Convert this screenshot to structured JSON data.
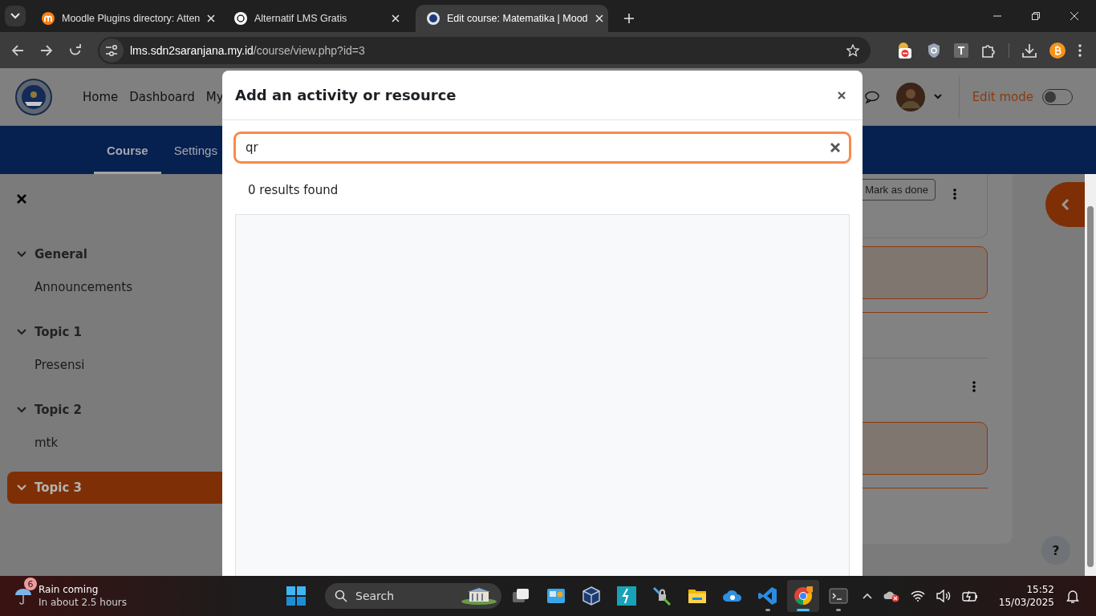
{
  "browser": {
    "tabs": [
      {
        "title": "Moodle Plugins directory: Atten",
        "kind": "moodle",
        "selected": false
      },
      {
        "title": "Alternatif LMS Gratis",
        "kind": "chat",
        "selected": false
      },
      {
        "title": "Edit course: Matematika | Mood",
        "kind": "school",
        "selected": true
      }
    ],
    "url": {
      "host": "lms.sdn2saranjana.my.id",
      "path": "/course/view.php?id=3"
    }
  },
  "site": {
    "nav": [
      "Home",
      "Dashboard",
      "My"
    ],
    "edit_mode": {
      "label": "Edit mode",
      "on": false
    }
  },
  "course_nav": {
    "tabs": [
      {
        "label": "Course",
        "selected": true
      },
      {
        "label": "Settings",
        "selected": false
      }
    ]
  },
  "drawer": {
    "sections": [
      {
        "title": "General",
        "expanded": true,
        "selected": false,
        "items": [
          "Announcements"
        ]
      },
      {
        "title": "Topic 1",
        "expanded": true,
        "selected": false,
        "items": [
          "Presensi"
        ]
      },
      {
        "title": "Topic 2",
        "expanded": true,
        "selected": false,
        "items": [
          "mtk"
        ]
      },
      {
        "title": "Topic 3",
        "expanded": true,
        "selected": true
      }
    ]
  },
  "content": {
    "mark_done_button": "Mark as done"
  },
  "help_button": "?",
  "modal": {
    "title": "Add an activity or resource",
    "search": {
      "value": "qr"
    },
    "results": "0 results found"
  },
  "taskbar": {
    "weather": {
      "badge": "6",
      "title": "Rain coming",
      "subtitle": "In about 2.5 hours"
    },
    "search": {
      "placeholder": "Search"
    },
    "apps": [
      {
        "kind": "taskview",
        "running": false,
        "active": false
      },
      {
        "kind": "widgets",
        "running": false,
        "active": false
      },
      {
        "kind": "box",
        "running": false,
        "active": false
      },
      {
        "kind": "bolt",
        "running": false,
        "active": false
      },
      {
        "kind": "lock",
        "running": false,
        "active": false
      },
      {
        "kind": "folder",
        "running": false,
        "active": false
      },
      {
        "kind": "cloud",
        "running": false,
        "active": false
      },
      {
        "kind": "code",
        "running": true,
        "active": false
      },
      {
        "kind": "browser",
        "running": true,
        "active": true
      },
      {
        "kind": "terminal",
        "running": true,
        "active": false
      }
    ],
    "clock": {
      "time": "15:52",
      "date": "15/03/2025"
    }
  }
}
